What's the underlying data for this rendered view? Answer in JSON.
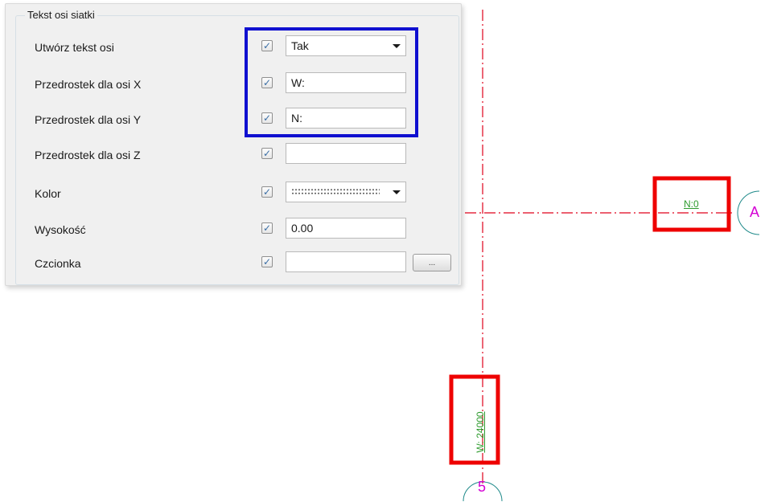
{
  "panel": {
    "group_title": "Tekst osi siatki",
    "rows": [
      {
        "label": "Utwórz tekst osi",
        "checked": true,
        "value": "Tak",
        "control": "combo"
      },
      {
        "label": "Przedrostek dla osi X",
        "checked": true,
        "value": "W:",
        "control": "text"
      },
      {
        "label": "Przedrostek dla osi Y",
        "checked": true,
        "value": "N:",
        "control": "text"
      },
      {
        "label": "Przedrostek dla osi Z",
        "checked": true,
        "value": "",
        "control": "text"
      },
      {
        "label": "Kolor",
        "checked": true,
        "value": "",
        "control": "color-combo"
      },
      {
        "label": "Wysokość",
        "checked": true,
        "value": "0.00",
        "control": "text"
      },
      {
        "label": "Czcionka",
        "checked": true,
        "value": "",
        "control": "text-browse"
      }
    ],
    "browse_label": "..."
  },
  "drawing": {
    "horizontal_axis_text": "N:0",
    "vertical_axis_text": "W: 24000",
    "bubble_horizontal": "A",
    "bubble_vertical": "5",
    "colors": {
      "axis_line": "#e0001a",
      "axis_text": "#2e9b2e",
      "bubble": "#1f8a8a",
      "bubble_label": "#d400d4",
      "highlight_red": "#ee0000",
      "highlight_blue": "#1010d0"
    }
  }
}
